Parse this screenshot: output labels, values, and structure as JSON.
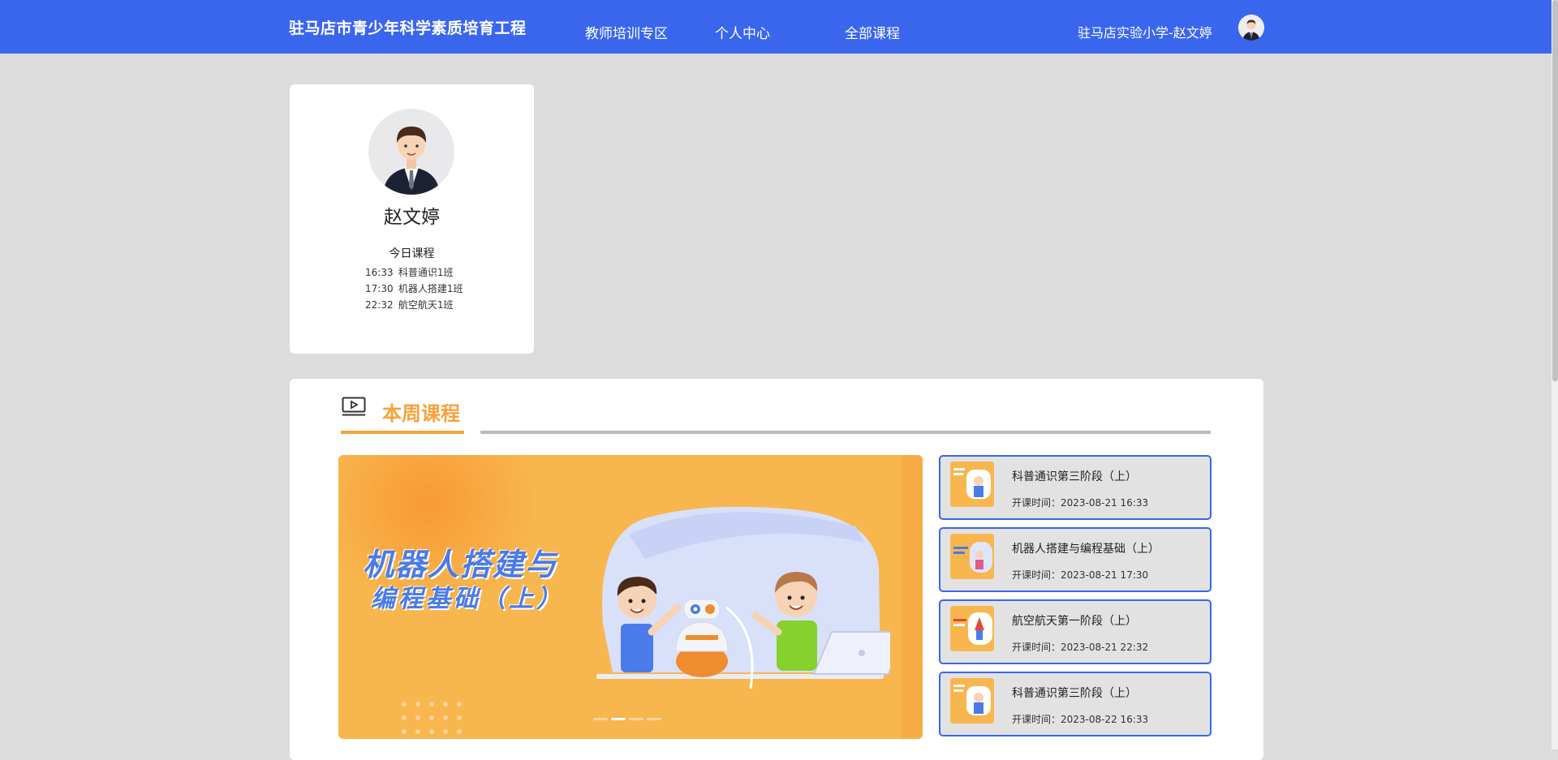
{
  "header": {
    "site_title": "驻马店市青少年科学素质培育工程",
    "nav": [
      "教师培训专区",
      "个人中心",
      "全部课程"
    ],
    "user_label": "驻马店实验小学-赵文婷"
  },
  "profile": {
    "name": "赵文婷",
    "today_title": "今日课程",
    "today_courses": [
      {
        "time": "16:33",
        "name": "科普通识1班"
      },
      {
        "time": "17:30",
        "name": "机器人搭建1班"
      },
      {
        "time": "22:32",
        "name": "航空航天1班"
      }
    ]
  },
  "week": {
    "title": "本周课程",
    "banner": {
      "line1": "机器人搭建与",
      "line2": "编程基础（上）",
      "page_count": 4,
      "active_page": 1
    },
    "courses": [
      {
        "title": "科普通识第三阶段（上）",
        "time": "开课时间：2023-08-21 16:33"
      },
      {
        "title": "机器人搭建与编程基础（上）",
        "time": "开课时间：2023-08-21 17:30"
      },
      {
        "title": "航空航天第一阶段（上）",
        "time": "开课时间：2023-08-21 22:32"
      },
      {
        "title": "科普通识第三阶段（上）",
        "time": "开课时间：2023-08-22 16:33"
      }
    ]
  },
  "colors": {
    "header_bg": "#3a66ee",
    "accent_orange": "#f9a13a",
    "item_border": "#3a66ee"
  }
}
